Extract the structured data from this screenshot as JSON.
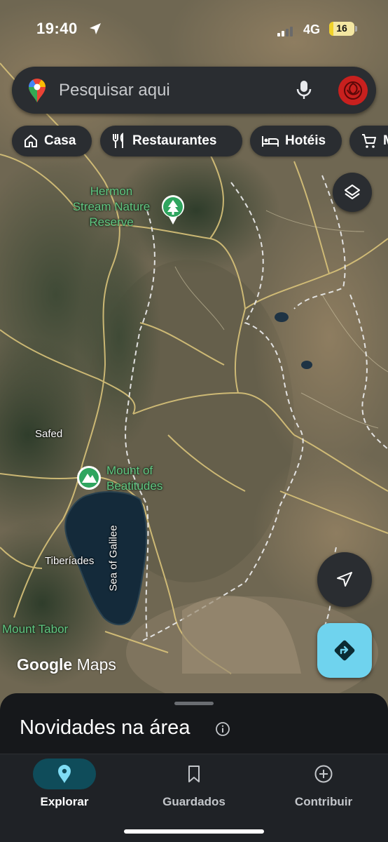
{
  "status_bar": {
    "time": "19:40",
    "network": "4G",
    "battery": "16",
    "battery_level": 0.16
  },
  "search": {
    "placeholder": "Pesquisar aqui"
  },
  "chips": [
    {
      "label": "Casa",
      "icon": "home-icon"
    },
    {
      "label": "Restaurantes",
      "icon": "restaurant-icon"
    },
    {
      "label": "Hotéis",
      "icon": "hotel-icon"
    },
    {
      "label": "M",
      "icon": "cart-icon"
    }
  ],
  "map": {
    "pois": [
      {
        "name": "Hermon Stream Nature Reserve",
        "lines": [
          "Hermon",
          "Stream Nature",
          "Reserve"
        ],
        "icon": "tree-icon"
      },
      {
        "name": "Mount of Beatitudes",
        "lines": [
          "Mount of",
          "Beatitudes"
        ],
        "icon": "mountain-icon"
      }
    ],
    "places": {
      "safed": "Safed",
      "tiberiades": "Tiberíades",
      "sea_of_galilee": "Sea of Galilee",
      "mount_tabor": "Mount Tabor"
    },
    "colors": {
      "poi_green": "#62c782",
      "border_dashed": "#e8e8e8",
      "road": "#d9c37a"
    }
  },
  "attribution": {
    "google": "Google",
    "maps": "Maps"
  },
  "sheet": {
    "title": "Novidades na área"
  },
  "bottom_nav": [
    {
      "label": "Explorar",
      "icon": "location-pin-icon",
      "active": true
    },
    {
      "label": "Guardados",
      "icon": "bookmark-icon",
      "active": false
    },
    {
      "label": "Contribuir",
      "icon": "add-circle-icon",
      "active": false
    }
  ],
  "accent": "#6fd3ee"
}
